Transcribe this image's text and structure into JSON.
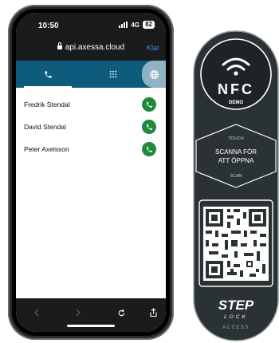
{
  "status": {
    "time": "10:50",
    "network": "4G",
    "battery": "82"
  },
  "browser": {
    "url": "api.axessa.cloud",
    "done_label": "Klar"
  },
  "tabs": [
    {
      "name": "phone",
      "icon": "phone-icon"
    },
    {
      "name": "dialpad",
      "icon": "dialpad-icon"
    },
    {
      "name": "web",
      "icon": "globe-icon"
    }
  ],
  "contacts": [
    {
      "name": "Fredrik Stendal"
    },
    {
      "name": "David Stendal"
    },
    {
      "name": "Peter Axelsson"
    }
  ],
  "tag": {
    "nfc": "NFC",
    "demo": "DEMO",
    "touch": "TOUCH",
    "instruction_line1": "SCANNA FÖR",
    "instruction_line2": "ATT ÖPPNA",
    "scan": "SCAN",
    "brand_top": "STEP",
    "brand_bottom": "LOCK",
    "brand_sub": "ACCESS"
  },
  "colors": {
    "tab_bar": "#0d5c7c",
    "call_green": "#1f8a3c",
    "link_blue": "#3d8ef8",
    "tag_bg": "#2b3234"
  }
}
